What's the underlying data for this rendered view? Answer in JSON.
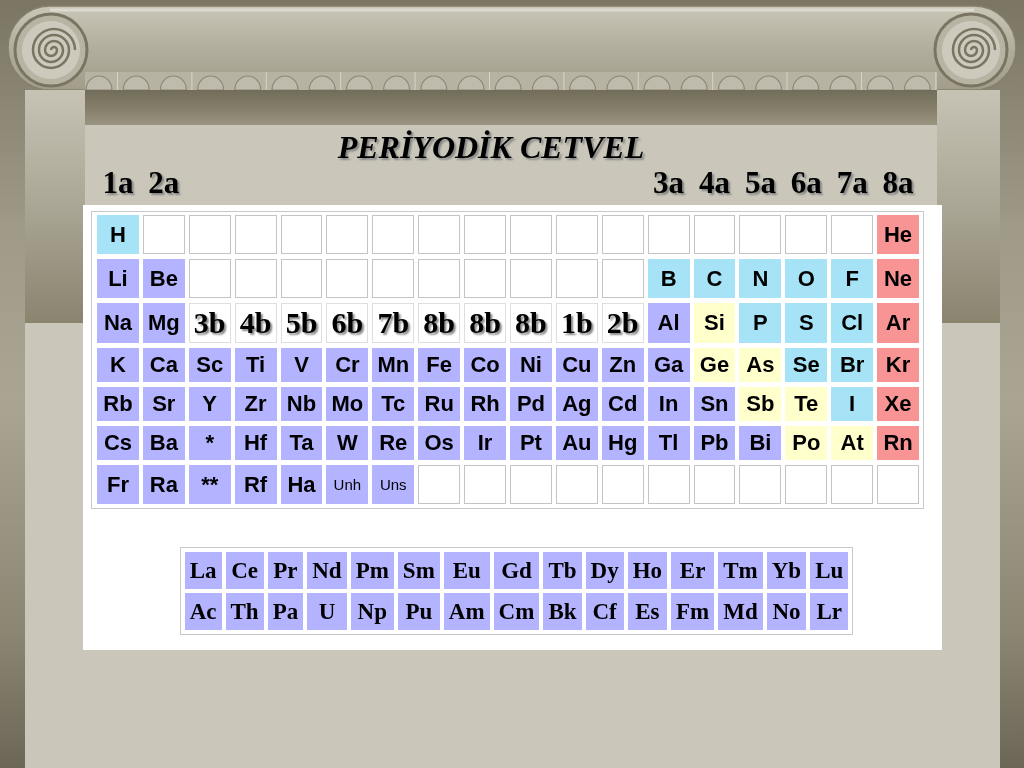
{
  "title": "PERİYODİK CETVEL",
  "group_labels": {
    "left": [
      "1a",
      "2a"
    ],
    "right": [
      "3a",
      "4a",
      "5a",
      "6a",
      "7a",
      "8a"
    ]
  },
  "table": {
    "rows": [
      {
        "cells": [
          {
            "kind": "element",
            "symbol": "H",
            "color": "#a6e3f7"
          },
          {
            "kind": "empty"
          },
          {
            "kind": "empty"
          },
          {
            "kind": "empty"
          },
          {
            "kind": "empty"
          },
          {
            "kind": "empty"
          },
          {
            "kind": "empty"
          },
          {
            "kind": "empty"
          },
          {
            "kind": "empty"
          },
          {
            "kind": "empty"
          },
          {
            "kind": "empty"
          },
          {
            "kind": "empty"
          },
          {
            "kind": "empty"
          },
          {
            "kind": "empty"
          },
          {
            "kind": "empty"
          },
          {
            "kind": "empty"
          },
          {
            "kind": "empty"
          },
          {
            "kind": "element",
            "symbol": "He",
            "color": "#f89494"
          }
        ]
      },
      {
        "cells": [
          {
            "kind": "element",
            "symbol": "Li",
            "color": "#b3b3ff"
          },
          {
            "kind": "element",
            "symbol": "Be",
            "color": "#b3b3ff"
          },
          {
            "kind": "empty"
          },
          {
            "kind": "empty"
          },
          {
            "kind": "empty"
          },
          {
            "kind": "empty"
          },
          {
            "kind": "empty"
          },
          {
            "kind": "empty"
          },
          {
            "kind": "empty"
          },
          {
            "kind": "empty"
          },
          {
            "kind": "empty"
          },
          {
            "kind": "empty"
          },
          {
            "kind": "element",
            "symbol": "B",
            "color": "#a6e3f7"
          },
          {
            "kind": "element",
            "symbol": "C",
            "color": "#a6e3f7"
          },
          {
            "kind": "element",
            "symbol": "N",
            "color": "#a6e3f7"
          },
          {
            "kind": "element",
            "symbol": "O",
            "color": "#a6e3f7"
          },
          {
            "kind": "element",
            "symbol": "F",
            "color": "#a6e3f7"
          },
          {
            "kind": "element",
            "symbol": "Ne",
            "color": "#f89494"
          }
        ]
      },
      {
        "cells": [
          {
            "kind": "element",
            "symbol": "Na",
            "color": "#b3b3ff"
          },
          {
            "kind": "element",
            "symbol": "Mg",
            "color": "#b3b3ff"
          },
          {
            "kind": "group",
            "label": "3b"
          },
          {
            "kind": "group",
            "label": "4b"
          },
          {
            "kind": "group",
            "label": "5b"
          },
          {
            "kind": "group",
            "label": "6b"
          },
          {
            "kind": "group",
            "label": "7b"
          },
          {
            "kind": "group",
            "label": "8b"
          },
          {
            "kind": "group",
            "label": "8b"
          },
          {
            "kind": "group",
            "label": "8b"
          },
          {
            "kind": "group",
            "label": "1b"
          },
          {
            "kind": "group",
            "label": "2b"
          },
          {
            "kind": "element",
            "symbol": "Al",
            "color": "#b3b3ff"
          },
          {
            "kind": "element",
            "symbol": "Si",
            "color": "#ffffcc"
          },
          {
            "kind": "element",
            "symbol": "P",
            "color": "#a6e3f7"
          },
          {
            "kind": "element",
            "symbol": "S",
            "color": "#a6e3f7"
          },
          {
            "kind": "element",
            "symbol": "Cl",
            "color": "#a6e3f7"
          },
          {
            "kind": "element",
            "symbol": "Ar",
            "color": "#f89494"
          }
        ]
      },
      {
        "cells": [
          {
            "kind": "element",
            "symbol": "K",
            "color": "#b3b3ff"
          },
          {
            "kind": "element",
            "symbol": "Ca",
            "color": "#b3b3ff"
          },
          {
            "kind": "element",
            "symbol": "Sc",
            "color": "#b3b3ff"
          },
          {
            "kind": "element",
            "symbol": "Ti",
            "color": "#b3b3ff"
          },
          {
            "kind": "element",
            "symbol": "V",
            "color": "#b3b3ff"
          },
          {
            "kind": "element",
            "symbol": "Cr",
            "color": "#b3b3ff"
          },
          {
            "kind": "element",
            "symbol": "Mn",
            "color": "#b3b3ff"
          },
          {
            "kind": "element",
            "symbol": "Fe",
            "color": "#b3b3ff"
          },
          {
            "kind": "element",
            "symbol": "Co",
            "color": "#b3b3ff"
          },
          {
            "kind": "element",
            "symbol": "Ni",
            "color": "#b3b3ff"
          },
          {
            "kind": "element",
            "symbol": "Cu",
            "color": "#b3b3ff"
          },
          {
            "kind": "element",
            "symbol": "Zn",
            "color": "#b3b3ff"
          },
          {
            "kind": "element",
            "symbol": "Ga",
            "color": "#b3b3ff"
          },
          {
            "kind": "element",
            "symbol": "Ge",
            "color": "#ffffcc"
          },
          {
            "kind": "element",
            "symbol": "As",
            "color": "#ffffcc"
          },
          {
            "kind": "element",
            "symbol": "Se",
            "color": "#a6e3f7"
          },
          {
            "kind": "element",
            "symbol": "Br",
            "color": "#a6e3f7"
          },
          {
            "kind": "element",
            "symbol": "Kr",
            "color": "#f89494"
          }
        ]
      },
      {
        "cells": [
          {
            "kind": "element",
            "symbol": "Rb",
            "color": "#b3b3ff"
          },
          {
            "kind": "element",
            "symbol": "Sr",
            "color": "#b3b3ff"
          },
          {
            "kind": "element",
            "symbol": "Y",
            "color": "#b3b3ff"
          },
          {
            "kind": "element",
            "symbol": "Zr",
            "color": "#b3b3ff"
          },
          {
            "kind": "element",
            "symbol": "Nb",
            "color": "#b3b3ff"
          },
          {
            "kind": "element",
            "symbol": "Mo",
            "color": "#b3b3ff"
          },
          {
            "kind": "element",
            "symbol": "Tc",
            "color": "#b3b3ff"
          },
          {
            "kind": "element",
            "symbol": "Ru",
            "color": "#b3b3ff"
          },
          {
            "kind": "element",
            "symbol": "Rh",
            "color": "#b3b3ff"
          },
          {
            "kind": "element",
            "symbol": "Pd",
            "color": "#b3b3ff"
          },
          {
            "kind": "element",
            "symbol": "Ag",
            "color": "#b3b3ff"
          },
          {
            "kind": "element",
            "symbol": "Cd",
            "color": "#b3b3ff"
          },
          {
            "kind": "element",
            "symbol": "In",
            "color": "#b3b3ff"
          },
          {
            "kind": "element",
            "symbol": "Sn",
            "color": "#b3b3ff"
          },
          {
            "kind": "element",
            "symbol": "Sb",
            "color": "#ffffcc"
          },
          {
            "kind": "element",
            "symbol": "Te",
            "color": "#ffffcc"
          },
          {
            "kind": "element",
            "symbol": "I",
            "color": "#a6e3f7"
          },
          {
            "kind": "element",
            "symbol": "Xe",
            "color": "#f89494"
          }
        ]
      },
      {
        "cells": [
          {
            "kind": "element",
            "symbol": "Cs",
            "color": "#b3b3ff"
          },
          {
            "kind": "element",
            "symbol": "Ba",
            "color": "#b3b3ff"
          },
          {
            "kind": "element",
            "symbol": "*",
            "color": "#b3b3ff"
          },
          {
            "kind": "element",
            "symbol": "Hf",
            "color": "#b3b3ff"
          },
          {
            "kind": "element",
            "symbol": "Ta",
            "color": "#b3b3ff"
          },
          {
            "kind": "element",
            "symbol": "W",
            "color": "#b3b3ff"
          },
          {
            "kind": "element",
            "symbol": "Re",
            "color": "#b3b3ff"
          },
          {
            "kind": "element",
            "symbol": "Os",
            "color": "#b3b3ff"
          },
          {
            "kind": "element",
            "symbol": "Ir",
            "color": "#b3b3ff"
          },
          {
            "kind": "element",
            "symbol": "Pt",
            "color": "#b3b3ff"
          },
          {
            "kind": "element",
            "symbol": "Au",
            "color": "#b3b3ff"
          },
          {
            "kind": "element",
            "symbol": "Hg",
            "color": "#b3b3ff"
          },
          {
            "kind": "element",
            "symbol": "Tl",
            "color": "#b3b3ff"
          },
          {
            "kind": "element",
            "symbol": "Pb",
            "color": "#b3b3ff"
          },
          {
            "kind": "element",
            "symbol": "Bi",
            "color": "#b3b3ff"
          },
          {
            "kind": "element",
            "symbol": "Po",
            "color": "#ffffcc"
          },
          {
            "kind": "element",
            "symbol": "At",
            "color": "#ffffcc"
          },
          {
            "kind": "element",
            "symbol": "Rn",
            "color": "#f89494"
          }
        ]
      },
      {
        "cells": [
          {
            "kind": "element",
            "symbol": "Fr",
            "color": "#b3b3ff"
          },
          {
            "kind": "element",
            "symbol": "Ra",
            "color": "#b3b3ff"
          },
          {
            "kind": "element",
            "symbol": "**",
            "color": "#b3b3ff"
          },
          {
            "kind": "element",
            "symbol": "Rf",
            "color": "#b3b3ff"
          },
          {
            "kind": "element",
            "symbol": "Ha",
            "color": "#b3b3ff"
          },
          {
            "kind": "provisional",
            "symbol": "Unh",
            "color": "#b3b3ff"
          },
          {
            "kind": "provisional",
            "symbol": "Uns",
            "color": "#b3b3ff"
          },
          {
            "kind": "empty"
          },
          {
            "kind": "empty"
          },
          {
            "kind": "empty"
          },
          {
            "kind": "empty"
          },
          {
            "kind": "empty"
          },
          {
            "kind": "empty"
          },
          {
            "kind": "empty"
          },
          {
            "kind": "empty"
          },
          {
            "kind": "empty"
          },
          {
            "kind": "empty"
          },
          {
            "kind": "empty"
          }
        ]
      }
    ]
  },
  "lanthanide_table": {
    "rows": [
      {
        "cells": [
          "La",
          "Ce",
          "Pr",
          "Nd",
          "Pm",
          "Sm",
          "Eu",
          "Gd",
          "Tb",
          "Dy",
          "Ho",
          "Er",
          "Tm",
          "Yb",
          "Lu"
        ]
      },
      {
        "cells": [
          "Ac",
          "Th",
          "Pa",
          "U",
          "Np",
          "Pu",
          "Am",
          "Cm",
          "Bk",
          "Cf",
          "Es",
          "Fm",
          "Md",
          "No",
          "Lr"
        ]
      }
    ]
  }
}
